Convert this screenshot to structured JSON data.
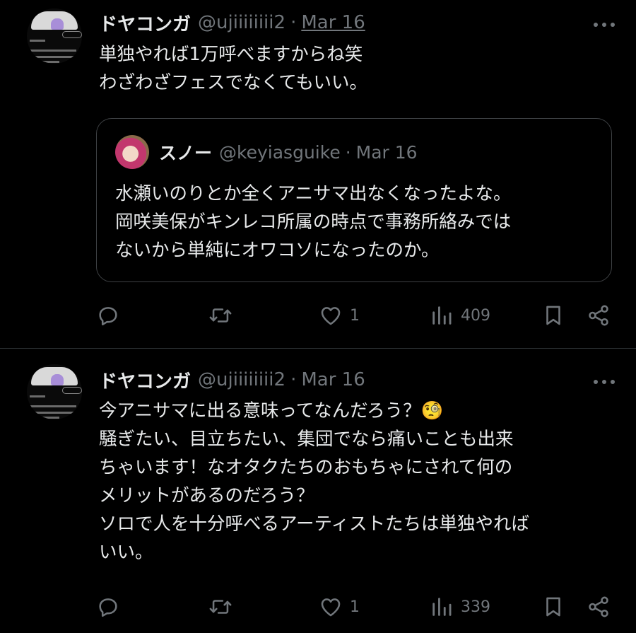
{
  "tweets": [
    {
      "author": "ドヤコンガ",
      "handle": "@ujiiiiiiii2",
      "sep": "·",
      "date": "Mar 16",
      "text": "単独やれば1万呼べますからね笑\nわざわざフェスでなくてもいい。",
      "quote": {
        "author": "スノー",
        "handle": "@keyiasguike",
        "sep": "·",
        "date": "Mar 16",
        "text": "水瀬いのりとか全くアニサマ出なくなったよな。\n岡咲美保がキンレコ所属の時点で事務所絡みでは\nないから単純にオワコソになったのか。"
      },
      "actions": {
        "replies": "",
        "retweets": "",
        "likes": "1",
        "views": "409"
      }
    },
    {
      "author": "ドヤコンガ",
      "handle": "@ujiiiiiiii2",
      "sep": "·",
      "date": "Mar 16",
      "text": "今アニサマに出る意味ってなんだろう？🧐\n騒ぎたい、目立ちたい、集団でなら痛いことも出来\nちゃいます！なオタクたちのおもちゃにされて何の\nメリットがあるのだろう？\nソロで人を十分呼べるアーティストたちは単独やれば\nいい。",
      "actions": {
        "replies": "",
        "retweets": "",
        "likes": "1",
        "views": "339"
      }
    }
  ],
  "icons": {
    "reply": "reply-icon",
    "retweet": "retweet-icon",
    "like": "heart-icon",
    "views": "views-icon",
    "bookmark": "bookmark-icon",
    "share": "share-icon",
    "more": "more-icon"
  },
  "colors": {
    "background": "#000000",
    "text": "#e7e9ea",
    "muted": "#71767b",
    "border": "#2f3336"
  }
}
